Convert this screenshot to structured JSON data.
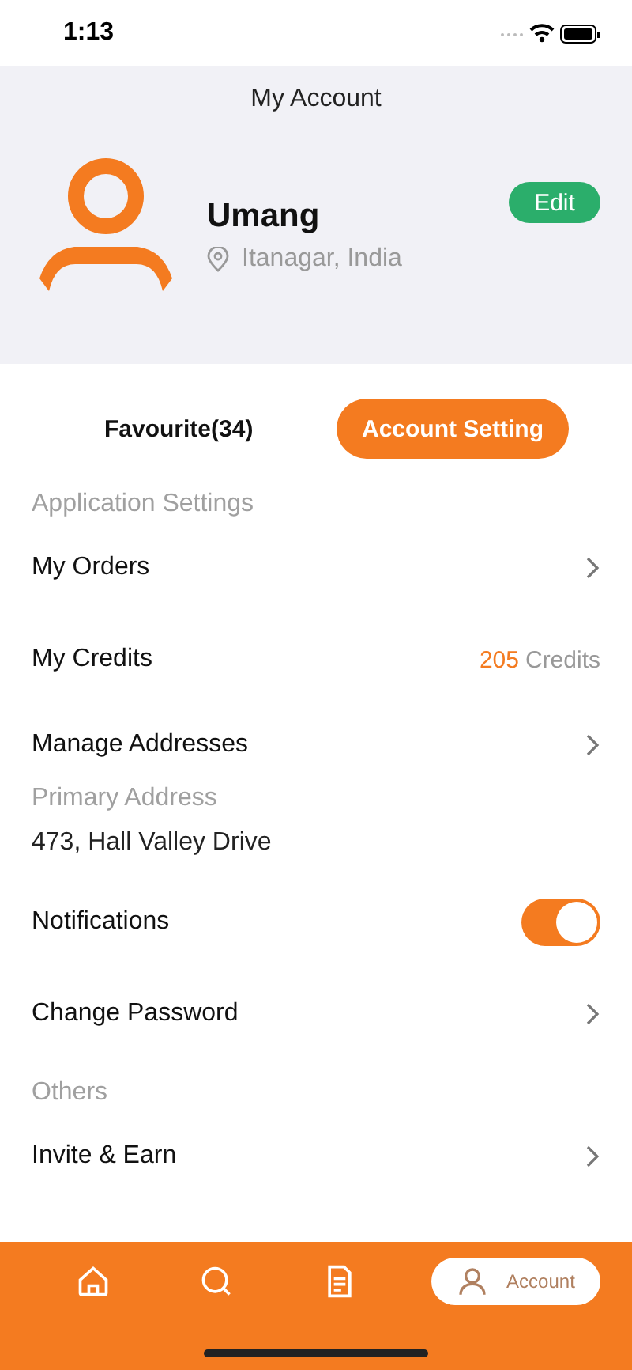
{
  "status_bar": {
    "time": "1:13"
  },
  "header": {
    "title": "My Account"
  },
  "profile": {
    "name": "Umang",
    "location": "Itanagar, India",
    "edit_label": "Edit"
  },
  "tabs": [
    {
      "label": "Favourite(34)",
      "selected": false
    },
    {
      "label": "Account Setting",
      "selected": true
    }
  ],
  "settings": [
    {
      "kind": "section",
      "label": "Application Settings"
    },
    {
      "kind": "nav",
      "label": "My Orders"
    },
    {
      "kind": "credits",
      "label": "My Credits",
      "value": "205",
      "unit": "Credits"
    },
    {
      "kind": "address",
      "label": "Manage Addresses",
      "caption": "Primary Address",
      "address": "473, Hall Valley Drive"
    },
    {
      "kind": "toggle",
      "label": "Notifications",
      "on": true
    },
    {
      "kind": "nav",
      "label": "Change Password"
    },
    {
      "kind": "section",
      "label": "Others"
    },
    {
      "kind": "nav",
      "label": "Invite & Earn"
    }
  ],
  "bottom_nav": [
    {
      "kind": "home",
      "selected": false
    },
    {
      "kind": "search",
      "selected": false
    },
    {
      "kind": "document",
      "selected": false
    },
    {
      "kind": "account",
      "label": "Account",
      "selected": true
    }
  ]
}
